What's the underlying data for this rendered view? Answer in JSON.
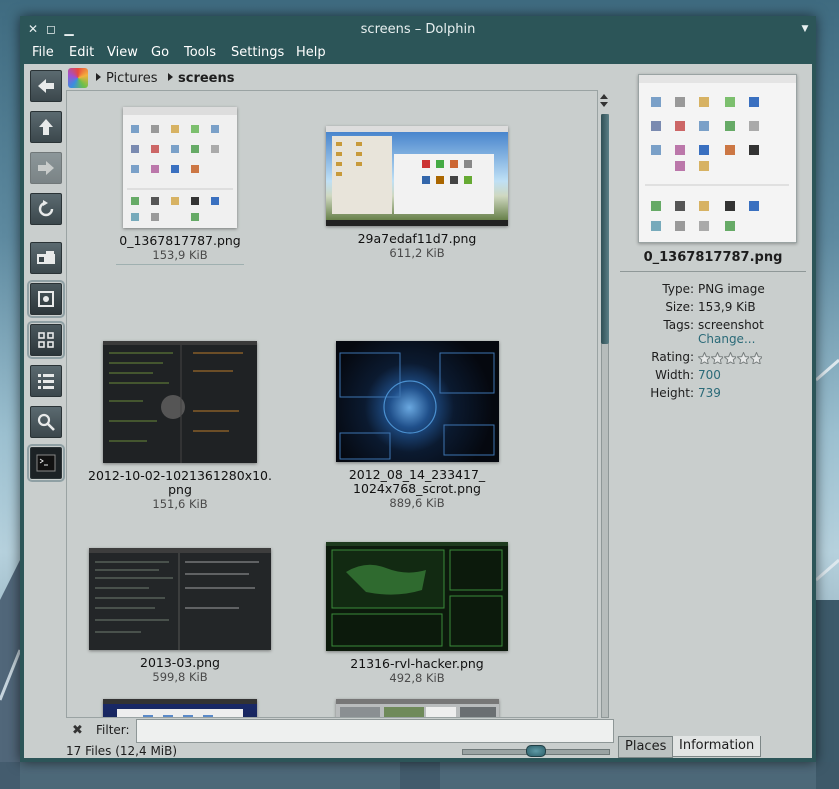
{
  "window": {
    "title": "screens – Dolphin"
  },
  "menu": [
    "File",
    "Edit",
    "View",
    "Go",
    "Tools",
    "Settings",
    "Help"
  ],
  "breadcrumb": {
    "parent": "Pictures",
    "current": "screens"
  },
  "toolbar_icons": [
    "back-icon",
    "up-icon",
    "forward-icon",
    "reload-icon",
    "split-view-icon",
    "preview-icon",
    "icons-view-icon",
    "details-view-icon",
    "search-icon",
    "terminal-icon"
  ],
  "files": [
    {
      "name": "0_1367817787.png",
      "size": "153,9 KiB",
      "selected": true
    },
    {
      "name": "29a7edaf11d7.png",
      "size": "611,2 KiB"
    },
    {
      "name": "2012-10-02-1021361280x10.\npng",
      "size": "151,6 KiB"
    },
    {
      "name": "2012_08_14_233417_\n1024x768_scrot.png",
      "size": "889,6 KiB"
    },
    {
      "name": "2013-03.png",
      "size": "599,8 KiB"
    },
    {
      "name": "21316-rvl-hacker.png",
      "size": "492,8 KiB"
    },
    {
      "name": "",
      "size": ""
    },
    {
      "name": "",
      "size": ""
    }
  ],
  "filter": {
    "label": "Filter:",
    "value": ""
  },
  "status": {
    "text": "17 Files (12,4 MiB)",
    "zoom_fraction": 0.5
  },
  "info_panel": {
    "file_name": "0_1367817787.png",
    "type_label": "Type:",
    "type_value": "PNG image",
    "size_label": "Size:",
    "size_value": "153,9 KiB",
    "tags_label": "Tags:",
    "tags_value": "screenshot",
    "change_link": "Change...",
    "rating_label": "Rating:",
    "rating_stars": 0,
    "width_label": "Width:",
    "width_value": "700",
    "height_label": "Height:",
    "height_value": "739"
  },
  "panel_tabs": {
    "places": "Places",
    "information": "Information"
  },
  "colors": {
    "window_frame": "#2c5558",
    "content_bg": "#c9cecd",
    "link": "#2a6a78"
  }
}
